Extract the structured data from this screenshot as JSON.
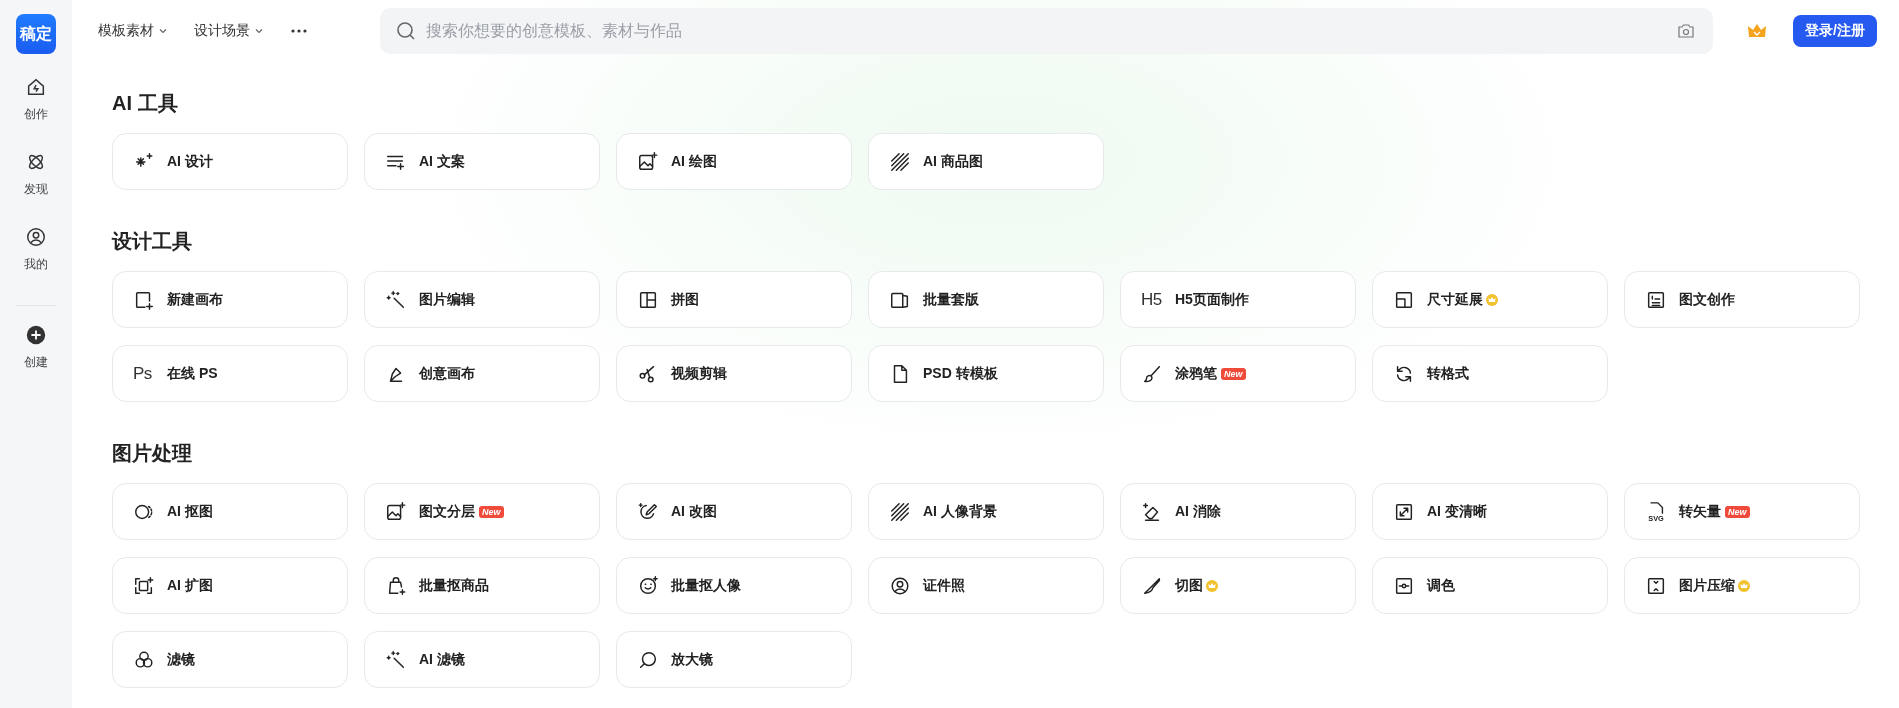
{
  "logo": {
    "text": "稿定"
  },
  "sidebar": {
    "items": [
      {
        "kind": "nav",
        "label": "创作"
      },
      {
        "kind": "nav",
        "label": "发现"
      },
      {
        "kind": "nav",
        "label": "我的"
      },
      {
        "kind": "create",
        "label": "创建"
      }
    ]
  },
  "topbar": {
    "menus": [
      {
        "label": "模板素材"
      },
      {
        "label": "设计场景"
      }
    ],
    "search": {
      "placeholder": "搜索你想要的创意模板、素材与作品"
    },
    "login_button": "登录/注册"
  },
  "sections": [
    {
      "title": "AI 工具",
      "items": [
        {
          "label": "AI 设计"
        },
        {
          "label": "AI 文案"
        },
        {
          "label": "AI 绘图"
        },
        {
          "label": "AI 商品图"
        }
      ]
    },
    {
      "title": "设计工具",
      "items": [
        {
          "label": "新建画布"
        },
        {
          "label": "图片编辑"
        },
        {
          "label": "拼图"
        },
        {
          "label": "批量套版"
        },
        {
          "label": "H5页面制作",
          "icon_text": "H5"
        },
        {
          "label": "尺寸延展",
          "badge": {
            "kind": "vip"
          }
        },
        {
          "label": "图文创作"
        },
        {
          "label": "在线 PS",
          "icon_text": "Ps"
        },
        {
          "label": "创意画布"
        },
        {
          "label": "视频剪辑"
        },
        {
          "label": "PSD 转模板"
        },
        {
          "label": "涂鸦笔",
          "badge": {
            "kind": "new",
            "text": "New"
          }
        },
        {
          "label": "转格式"
        }
      ]
    },
    {
      "title": "图片处理",
      "items": [
        {
          "label": "AI 抠图"
        },
        {
          "label": "图文分层",
          "badge": {
            "kind": "new",
            "text": "New"
          }
        },
        {
          "label": "AI 改图"
        },
        {
          "label": "AI 人像背景"
        },
        {
          "label": "AI 消除"
        },
        {
          "label": "AI 变清晰"
        },
        {
          "label": "转矢量",
          "icon_text": "SVG",
          "badge": {
            "kind": "new",
            "text": "New"
          }
        },
        {
          "label": "AI 扩图"
        },
        {
          "label": "批量抠商品"
        },
        {
          "label": "批量抠人像"
        },
        {
          "label": "证件照"
        },
        {
          "label": "切图",
          "badge": {
            "kind": "vip"
          }
        },
        {
          "label": "调色"
        },
        {
          "label": "图片压缩",
          "badge": {
            "kind": "vip"
          }
        },
        {
          "label": "滤镜"
        },
        {
          "label": "AI 滤镜"
        },
        {
          "label": "放大镜"
        }
      ]
    }
  ]
}
